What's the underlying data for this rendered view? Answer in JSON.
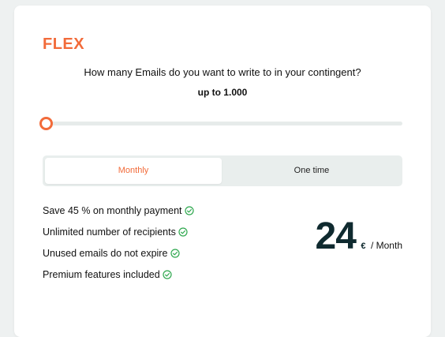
{
  "plan": {
    "title": "FLEX",
    "question": "How many Emails do you want to write to in your contingent?",
    "amount_label": "up to 1.000",
    "slider_level": 0
  },
  "billing_toggle": {
    "monthly_label": "Monthly",
    "one_time_label": "One time",
    "selected": "Monthly"
  },
  "features": [
    {
      "label": "Save 45 % on monthly payment",
      "icon": "check-circle-icon"
    },
    {
      "label": "Unlimited number of recipients",
      "icon": "check-circle-icon"
    },
    {
      "label": "Unused emails do not expire",
      "icon": "check-circle-icon"
    },
    {
      "label": "Premium features included",
      "icon": "check-circle-icon"
    }
  ],
  "price": {
    "amount": "24",
    "currency": "€",
    "period": "/ Month"
  },
  "colors": {
    "accent": "#f26b3a",
    "price_text": "#0f2a2f",
    "check": "#2fa84f",
    "toggle_bg": "#e9eeed",
    "page_bg": "#eef1f1"
  }
}
